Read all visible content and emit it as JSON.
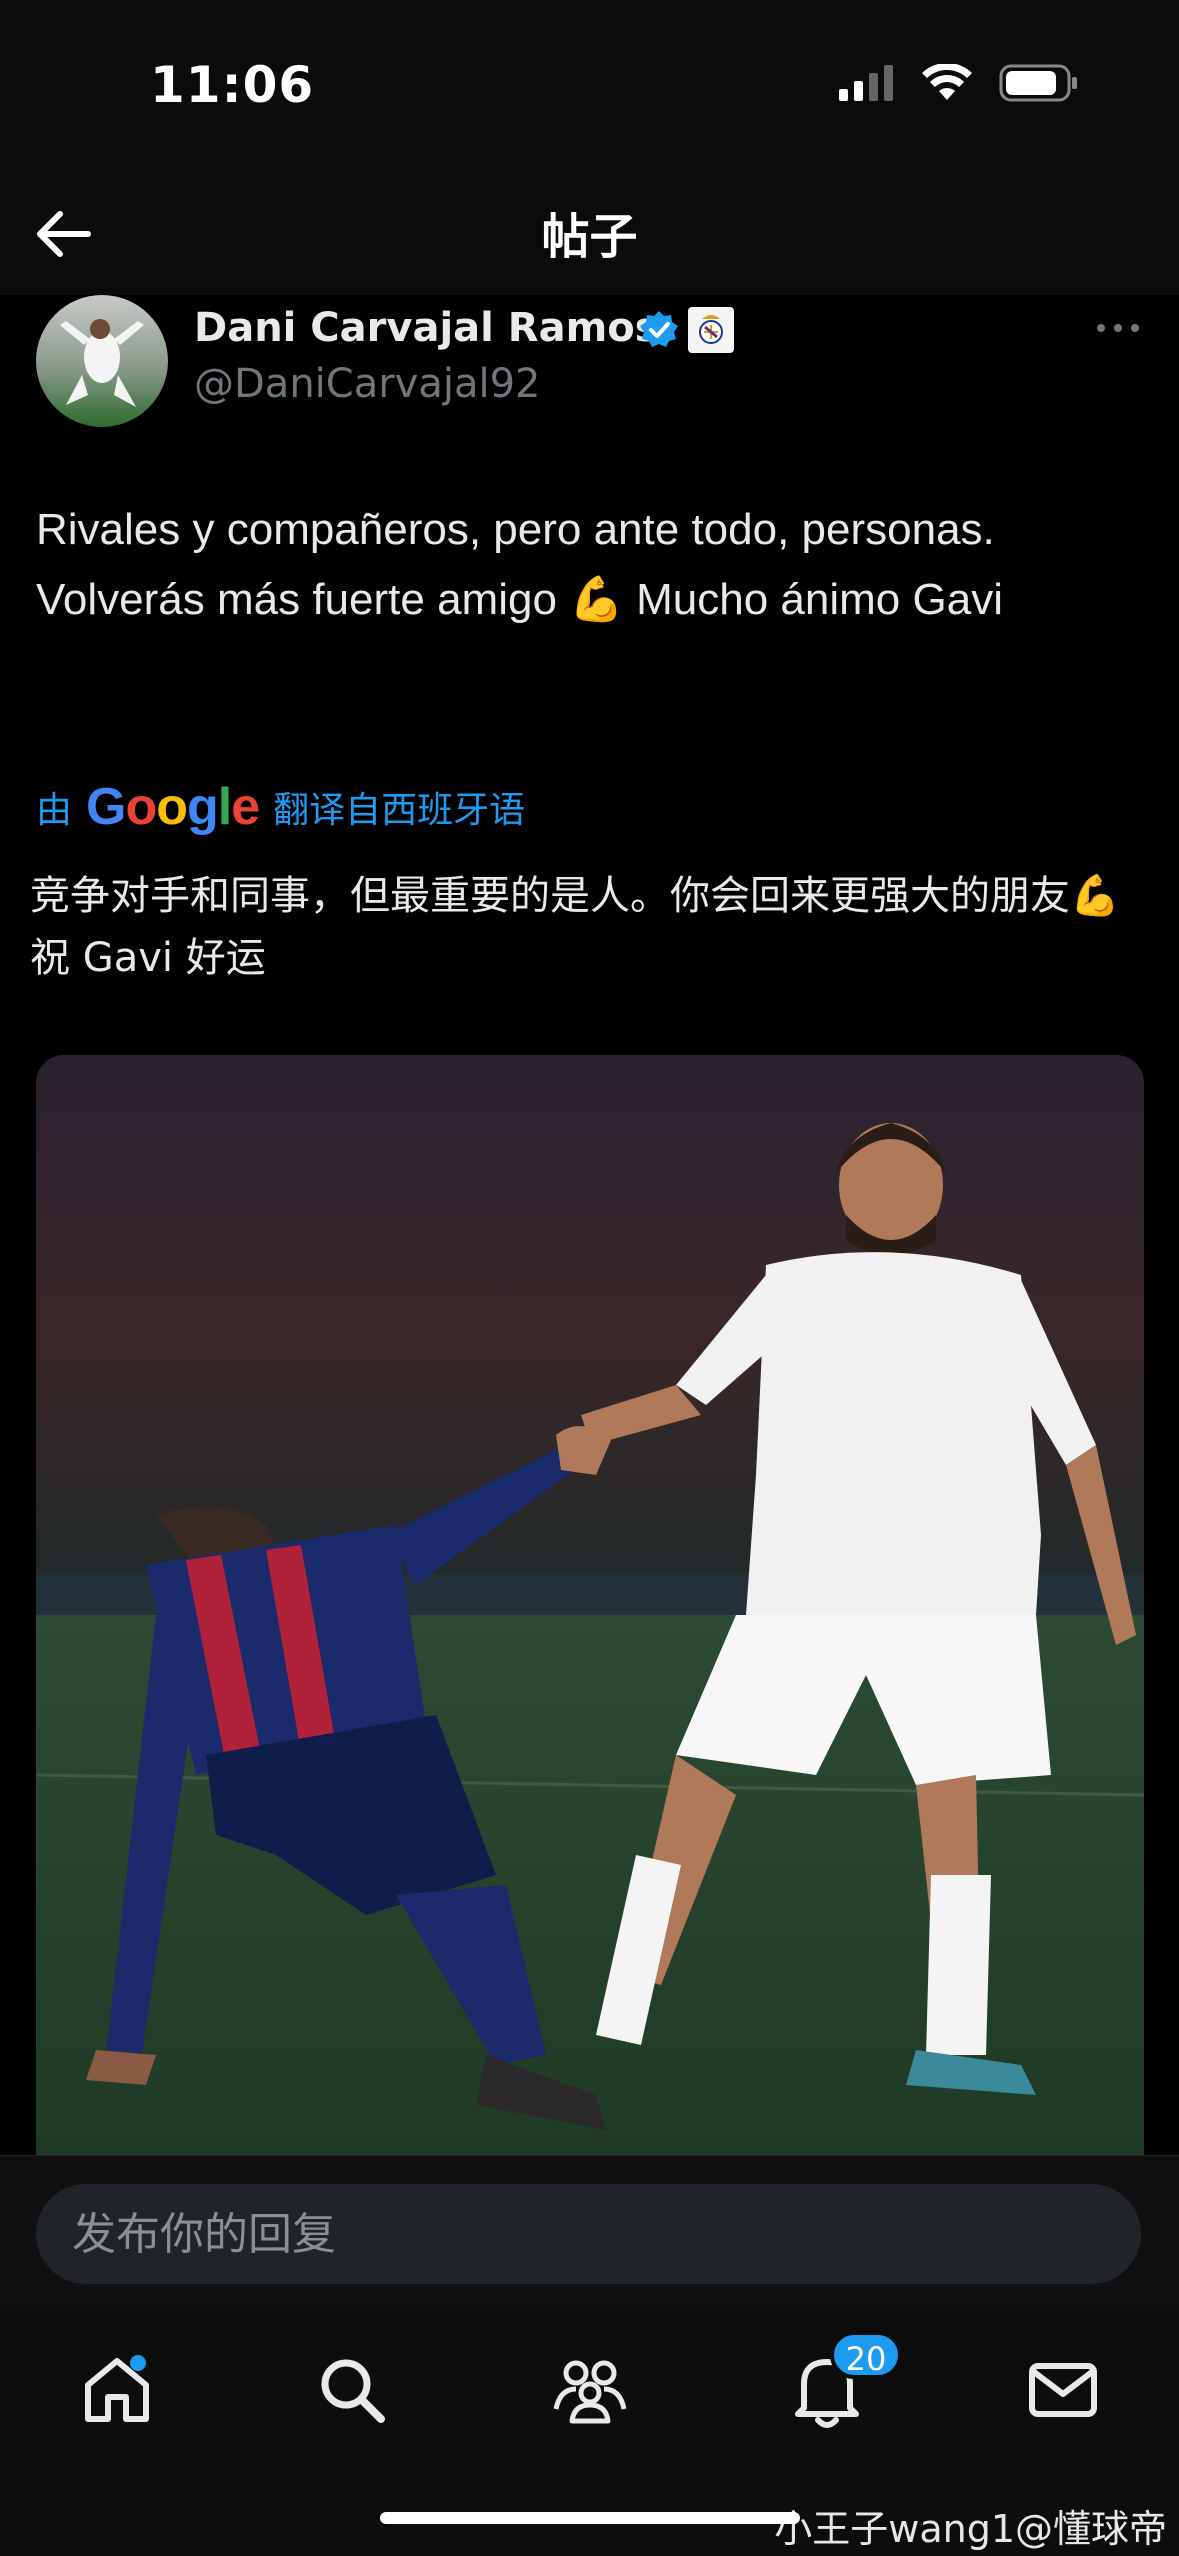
{
  "status_bar": {
    "time": "11:06"
  },
  "nav": {
    "title": "帖子"
  },
  "post": {
    "author_name": "Dani Carvajal Ramos",
    "handle": "@DaniCarvajal92",
    "text": "Rivales y compañeros, pero ante todo, personas. Volverás más fuerte amigo 💪 Mucho ánimo Gavi",
    "translation": {
      "prefix": "由",
      "provider": "Google",
      "suffix": "翻译自西班牙语",
      "text": "竞争对手和同事，但最重要的是人。你会回来更强大的朋友💪祝 Gavi 好运"
    }
  },
  "reply": {
    "placeholder": "发布你的回复"
  },
  "tabbar": {
    "notifications_badge": "20"
  },
  "watermark": "小王子wang1@懂球帝",
  "colors": {
    "accent": "#1d9bf0",
    "background": "#000000",
    "text": "#e7e9ea",
    "muted": "#71767b"
  },
  "icons": [
    "back-arrow-icon",
    "verified-icon",
    "more-icon",
    "home-icon",
    "search-icon",
    "communities-icon",
    "bell-icon",
    "mail-icon"
  ]
}
